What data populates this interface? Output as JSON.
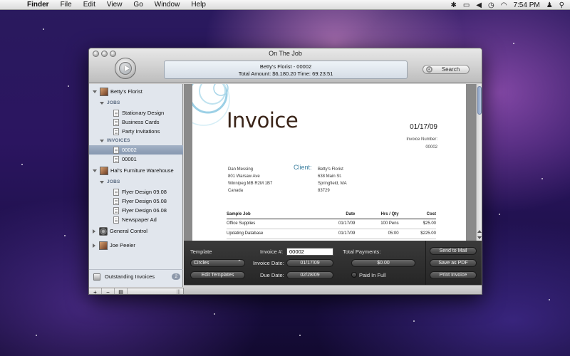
{
  "menubar": {
    "app": "Finder",
    "items": [
      "File",
      "Edit",
      "View",
      "Go",
      "Window",
      "Help"
    ],
    "time": "7:54 PM"
  },
  "window": {
    "title": "On The Job",
    "status_line1": "Betty's Florist - 00002",
    "status_line2": "Total Amount: $6,180.20  Time: 69:23:51",
    "search_label": "Search"
  },
  "sidebar": {
    "clients": [
      {
        "name": "Betty's Florist"
      },
      {
        "name": "Hal's Furniture Warehouse"
      },
      {
        "name": "General Control"
      },
      {
        "name": "Joe Peeler"
      }
    ],
    "jobs_header": "JOBS",
    "invoices_header": "INVOICES",
    "bettys_jobs": [
      "Stationary Design",
      "Business Cards",
      "Party Invitations"
    ],
    "bettys_invoices": [
      "00002",
      "00001"
    ],
    "hals_jobs": [
      "Flyer Design 09.08",
      "Flyer Design 05.08",
      "Flyer Design 06.08",
      "Newspaper Ad"
    ],
    "outstanding_label": "Outstanding Invoices",
    "outstanding_count": "2",
    "toolbar": {
      "add": "+",
      "remove": "−"
    }
  },
  "invoice": {
    "title": "Invoice",
    "date": "01/17/09",
    "number_label": "Invoice Number:",
    "number": "00002",
    "client_label": "Client:",
    "from": [
      "Dan Messing",
      "801 Warsaw Ave",
      "Winnipeg MB R2M 1B7",
      "Canada"
    ],
    "to": [
      "Betty's Florist",
      "638 Main St.",
      "Springfield, MA",
      "83729"
    ],
    "columns": [
      "Sample Job",
      "Date",
      "Hrs / Qty",
      "Cost"
    ],
    "rows": [
      [
        "Office Supplies",
        "01/17/09",
        "100 Pens",
        "$25.00"
      ],
      [
        "Updating Database",
        "01/17/09",
        "05:00",
        "$225.00"
      ]
    ]
  },
  "panel": {
    "template_label": "Template",
    "template_value": "Circles",
    "edit_templates": "Edit Templates",
    "invoice_num_label": "Invoice #:",
    "invoice_num_value": "00002",
    "invoice_date_label": "Invoice Date:",
    "invoice_date_value": "01/17/09",
    "due_date_label": "Due Date:",
    "due_date_value": "02/28/09",
    "total_payments_label": "Total Payments:",
    "total_payments_value": "$0.00",
    "paid_in_full": "Paid In Full",
    "send_to_mail": "Send to Mail",
    "save_as_pdf": "Save as PDF",
    "print_invoice": "Print Invoice"
  }
}
